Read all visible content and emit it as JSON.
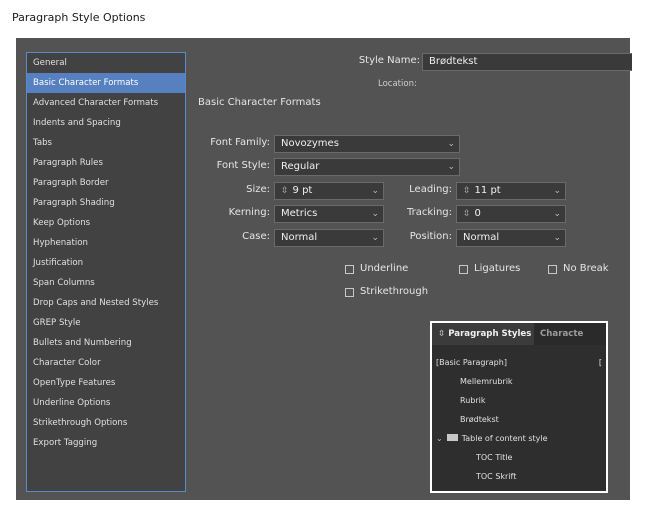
{
  "window": {
    "title": "Paragraph Style Options"
  },
  "sidebar": {
    "items": [
      {
        "label": "General"
      },
      {
        "label": "Basic Character Formats"
      },
      {
        "label": "Advanced Character Formats"
      },
      {
        "label": "Indents and Spacing"
      },
      {
        "label": "Tabs"
      },
      {
        "label": "Paragraph Rules"
      },
      {
        "label": "Paragraph Border"
      },
      {
        "label": "Paragraph Shading"
      },
      {
        "label": "Keep Options"
      },
      {
        "label": "Hyphenation"
      },
      {
        "label": "Justification"
      },
      {
        "label": "Span Columns"
      },
      {
        "label": "Drop Caps and Nested Styles"
      },
      {
        "label": "GREP Style"
      },
      {
        "label": "Bullets and Numbering"
      },
      {
        "label": "Character Color"
      },
      {
        "label": "OpenType Features"
      },
      {
        "label": "Underline Options"
      },
      {
        "label": "Strikethrough Options"
      },
      {
        "label": "Export Tagging"
      }
    ],
    "selected": "Basic Character Formats"
  },
  "header": {
    "style_name_label": "Style Name:",
    "style_name_value": "Brødtekst",
    "location_label": "Location:"
  },
  "section": {
    "title": "Basic Character Formats"
  },
  "form": {
    "font_family": {
      "label": "Font Family:",
      "value": "Novozymes"
    },
    "font_style": {
      "label": "Font Style:",
      "value": "Regular"
    },
    "size": {
      "label": "Size:",
      "value": "9 pt"
    },
    "leading": {
      "label": "Leading:",
      "value": "11 pt"
    },
    "kerning": {
      "label": "Kerning:",
      "value": "Metrics"
    },
    "tracking": {
      "label": "Tracking:",
      "value": "0"
    },
    "case": {
      "label": "Case:",
      "value": "Normal"
    },
    "position": {
      "label": "Position:",
      "value": "Normal"
    }
  },
  "checkboxes": {
    "underline": "Underline",
    "ligatures": "Ligatures",
    "no_break": "No Break",
    "strikethrough": "Strikethrough"
  },
  "paragraph_styles_panel": {
    "tab_active": "Paragraph Styles",
    "tab_other": "Characte",
    "items": {
      "basic": "[Basic Paragraph]",
      "basic_suffix": "[",
      "mellemrubrik": "Mellemrubrik",
      "rubrik": "Rubrik",
      "brodtekst": "Brødtekst",
      "toc_group": "Table of content style",
      "toc_title": "TOC Title",
      "toc_skrift": "TOC Skrift"
    }
  },
  "icons": {
    "spinner": "spinner-arrows-icon",
    "dropdown": "chevron-down-icon",
    "folder": "folder-icon"
  }
}
